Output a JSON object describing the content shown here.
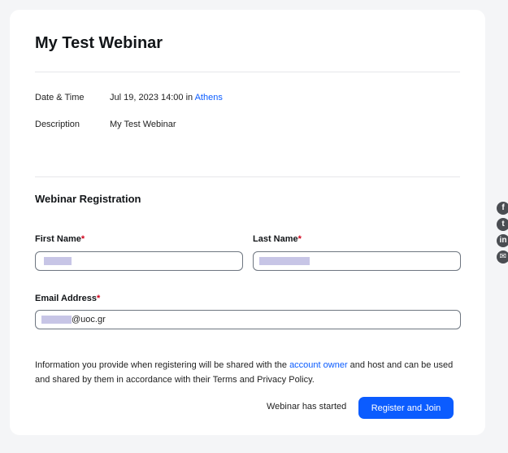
{
  "webinar": {
    "title": "My Test Webinar",
    "date_label": "Date & Time",
    "date_value": "Jul 19, 2023 14:00 in ",
    "timezone_link": "Athens",
    "description_label": "Description",
    "description_value": "My Test Webinar"
  },
  "registration": {
    "section_title": "Webinar Registration",
    "first_name_label": "First Name",
    "last_name_label": "Last Name",
    "email_label": "Email Address",
    "required_mark": "*",
    "email_value_visible": "@uoc.gr"
  },
  "info": {
    "text_before": "Information you provide when registering will be shared with the ",
    "account_owner_link": "account owner",
    "text_after": " and host and can be used and shared by them in accordance with their Terms and Privacy Policy."
  },
  "footer": {
    "status_text": "Webinar has started",
    "register_button": "Register and Join"
  },
  "share_icons": [
    "facebook-icon",
    "twitter-icon",
    "linkedin-icon",
    "email-icon"
  ],
  "colors": {
    "accent": "#0b5cff",
    "required": "#d0021b",
    "redaction": "#c7c5e6"
  }
}
